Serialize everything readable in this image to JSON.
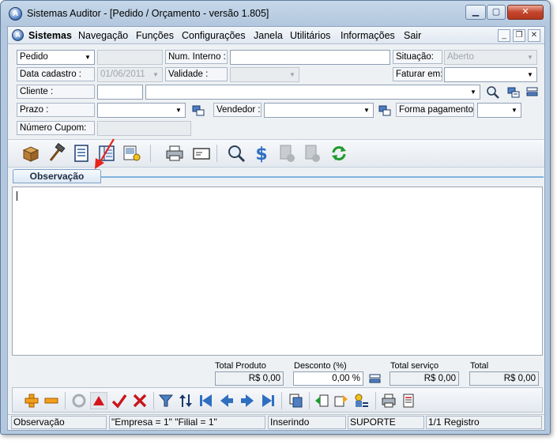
{
  "window": {
    "title": "Sistemas Auditor - [Pedido / Orçamento - versão 1.805]"
  },
  "menu": {
    "items": [
      "Sistemas",
      "Navegação",
      "Funções",
      "Configurações",
      "Janela",
      "Utilitários",
      "Informações",
      "Sair"
    ]
  },
  "form": {
    "tipo": "Pedido",
    "num_interno_label": "Num. Interno :",
    "num_interno_value": "",
    "situacao_label": "Situação:",
    "situacao_value": "Aberto",
    "data_cadastro_label": "Data cadastro :",
    "data_cadastro_value": "01/06/2011",
    "validade_label": "Validade :",
    "validade_value": "",
    "faturar_em_label": "Faturar em:",
    "faturar_em_value": "",
    "cliente_label": "Cliente :",
    "cliente_code": "",
    "cliente_name": "",
    "prazo_label": "Prazo :",
    "prazo_value": "",
    "vendedor_label": "Vendedor :",
    "vendedor_value": "",
    "forma_pagamento_label": "Forma pagamento:",
    "forma_pagamento_value": "",
    "numero_cupom_label": "Número Cupom:",
    "numero_cupom_value": ""
  },
  "tabs": {
    "active": "Observação"
  },
  "totals": {
    "total_produto_label": "Total Produto",
    "total_produto_value": "R$ 0,00",
    "desconto_label": "Desconto (%)",
    "desconto_value": "0,00 %",
    "total_servico_label": "Total serviço",
    "total_servico_value": "R$ 0,00",
    "total_label": "Total",
    "total_value": "R$ 0,00"
  },
  "status": {
    "context": "Observação",
    "empresa_filial": "\"Empresa = 1\"   \"Filial = 1\"",
    "mode": "Inserindo",
    "user": "SUPORTE",
    "registro": "1/1 Registro"
  },
  "colors": {
    "accent": "#4f7fc1",
    "close_button": "#c4452c",
    "red_arrow": "#e8231c",
    "add_icon": "#f2a01c",
    "confirm_check": "#c8151b"
  },
  "icons": {
    "toolbar": [
      "product-box-icon",
      "hammer-icon",
      "document-list-icon",
      "book-icon",
      "image-user-icon",
      "printer-icon",
      "card-icon",
      "search-icon",
      "dollar-icon",
      "document-disabled-icon",
      "document-disabled-icon",
      "refresh-icon"
    ],
    "navbar": [
      "add-icon",
      "remove-icon",
      "restore-icon",
      "up-triangle-icon",
      "check-icon",
      "cancel-icon",
      "filter-icon",
      "sort-icon",
      "first-icon",
      "prev-icon",
      "next-icon",
      "last-icon",
      "copy-icon",
      "import-icon",
      "export-icon",
      "user-icon",
      "print-icon",
      "report-icon"
    ]
  }
}
